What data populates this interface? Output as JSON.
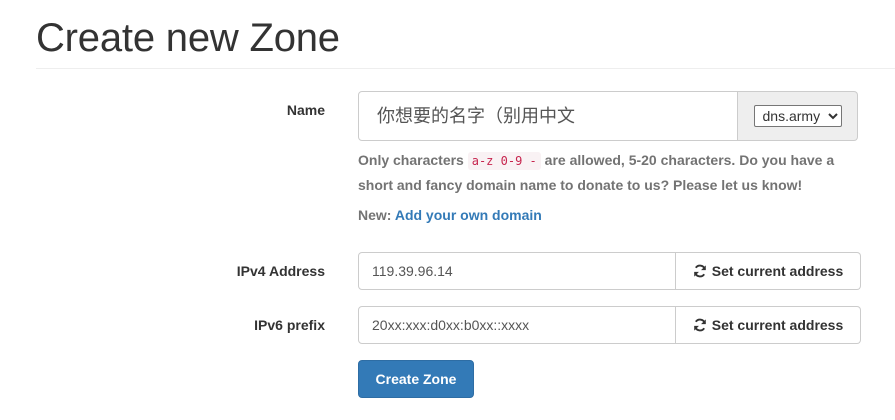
{
  "page": {
    "title": "Create new Zone"
  },
  "name_field": {
    "label": "Name",
    "placeholder": "你想要的名字（别用中文",
    "value": "",
    "domain_options": [
      "dns.army"
    ],
    "domain_selected": "dns.army"
  },
  "help": {
    "prefix": "Only characters ",
    "allowed_chars": "a-z 0-9 -",
    "suffix": " are allowed, 5-20 characters. Do you have a short and fancy domain name to donate to us? Please let us know!",
    "new_prefix": "New: ",
    "add_domain_link": "Add your own domain"
  },
  "ipv4": {
    "label": "IPv4 Address",
    "value": "119.39.96.14",
    "button_label": "Set current address"
  },
  "ipv6": {
    "label": "IPv6 prefix",
    "value": "20xx:xxx:d0xx:b0xx::xxxx",
    "button_label": "Set current address"
  },
  "submit": {
    "label": "Create Zone"
  },
  "icons": {
    "refresh": "refresh-icon"
  },
  "colors": {
    "primary": "#337ab7",
    "link": "#337ab7",
    "code_text": "#c7254e",
    "code_bg": "#f9f2f4",
    "help_text": "#737373"
  }
}
